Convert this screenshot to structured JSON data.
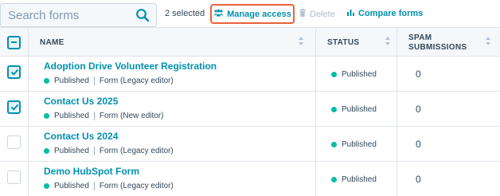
{
  "toolbar": {
    "search_placeholder": "Search forms",
    "selected_count": "2 selected",
    "manage_access_label": "Manage access",
    "delete_label": "Delete",
    "compare_label": "Compare forms"
  },
  "table": {
    "columns": {
      "name": "NAME",
      "status": "STATUS",
      "spam_line1": "SPAM",
      "spam_line2": "SUBMISSIONS"
    },
    "rows": [
      {
        "name": "Adoption Drive Volunteer Registration",
        "state": "Published",
        "type": "Form (Legacy editor)",
        "status": "Published",
        "spam": "0",
        "checked": true
      },
      {
        "name": "Contact Us 2025",
        "state": "Published",
        "type": "Form (New editor)",
        "status": "Published",
        "spam": "0",
        "checked": true
      },
      {
        "name": "Contact Us 2024",
        "state": "Published",
        "type": "Form (Legacy editor)",
        "status": "Published",
        "spam": "0",
        "checked": false
      },
      {
        "name": "Demo HubSpot Form",
        "state": "Published",
        "type": "Form (Legacy editor)",
        "status": "Published",
        "spam": "0",
        "checked": false
      }
    ]
  },
  "colors": {
    "accent": "#0091ae",
    "published": "#00bda5",
    "highlight": "#e8623a"
  },
  "icons": [
    "search-icon",
    "users-icon",
    "trash-icon",
    "bar-chart-icon",
    "sort-icon",
    "check-icon"
  ]
}
